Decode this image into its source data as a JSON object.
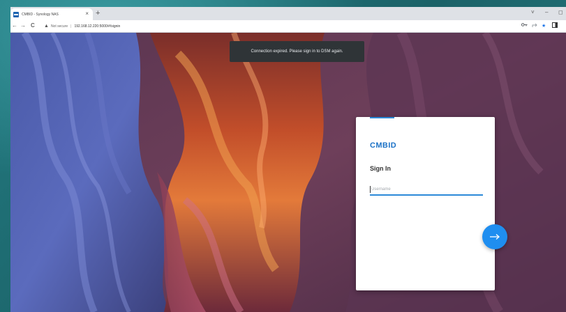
{
  "browser": {
    "tab_title": "CMBID - Synology NAS",
    "tab_close": "×",
    "new_tab": "+",
    "window_controls": [
      "˅",
      "–",
      "◻"
    ],
    "nav": {
      "back": "←",
      "forward": "→",
      "reload": "C"
    },
    "security_label": "Not secure",
    "url": "192.168.12.220:5000/#/signin",
    "toolbar_icons": [
      "key-icon",
      "share-icon",
      "star-icon",
      "sidebar-icon"
    ]
  },
  "toast": {
    "message": "Connection expired. Please sign in to DSM again."
  },
  "login": {
    "brand": "CMBID",
    "heading": "Sign In",
    "username_placeholder": "Username",
    "username_value": "",
    "submit_icon": "arrow-right-icon"
  },
  "colors": {
    "accent": "#2c8ad8",
    "brand": "#1d73c7",
    "submit_button": "#1f8ef0",
    "toast_bg": "#2f3437",
    "desktop": "#1f6b72"
  }
}
